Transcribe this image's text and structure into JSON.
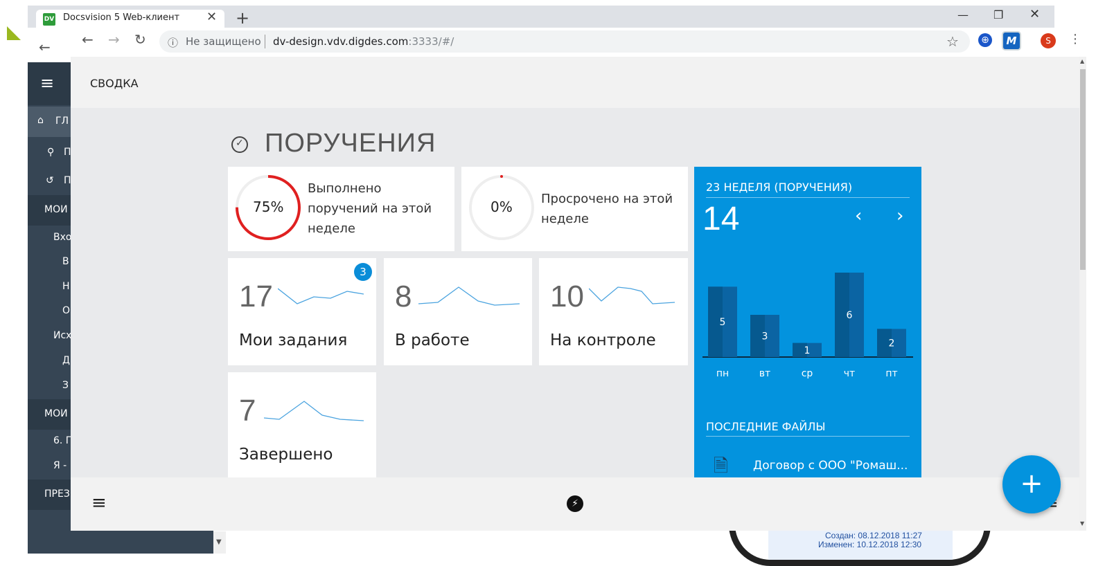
{
  "browser": {
    "tab_title": "Docsvision 5 Web-клиент",
    "tab_favicon": "DV",
    "omnibox_security": "Не защищено",
    "url_host": "dv-design.vdv.digdes.com",
    "url_rest": ":3333/#/",
    "profile_initial": "S",
    "ext_label": "M"
  },
  "background_sidebar": {
    "home": "ГЛ",
    "search": "П",
    "history": "П",
    "section1": "МОИ",
    "item1": "Вхо",
    "item2": "В",
    "item3": "Н",
    "item4": "О",
    "item5": "Исх",
    "item6": "Д",
    "item7": "З",
    "section2": "МОИ",
    "item8": "6. Г",
    "item9": "Я -",
    "section3": "ПРЕЗ"
  },
  "background_phone": {
    "created": "Создан: 08.12.2018 11:27",
    "modified": "Изменен: 10.12.2018 12:30"
  },
  "app": {
    "header_title": "СВОДКА",
    "section_title": "ПОРУЧЕНИЯ",
    "done_card": {
      "percent_label": "75%",
      "percent_value": 0.75,
      "description": "Выполнено поручений на этой неделе"
    },
    "overdue_card": {
      "percent_label": "0%",
      "percent_value": 0.0,
      "description": "Просрочено на этой неделе"
    },
    "stats": [
      {
        "value": "17",
        "label": "Мои задания",
        "badge": "3"
      },
      {
        "value": "8",
        "label": "В работе"
      },
      {
        "value": "10",
        "label": "На контроле"
      },
      {
        "value": "7",
        "label": "Завершено"
      }
    ],
    "week_panel": {
      "title": "23 НЕДЕЛЯ (ПОРУЧЕНИЯ)",
      "count": "14",
      "prev": "‹",
      "next": "›",
      "files_title": "ПОСЛЕДНИЕ ФАЙЛЫ",
      "file_name": "Договор с ООО \"Ромаш..."
    },
    "fab_label": "+"
  },
  "chart_data": {
    "type": "bar",
    "categories": [
      "пн",
      "вт",
      "ср",
      "чт",
      "пт"
    ],
    "values": [
      5,
      3,
      1,
      6,
      2
    ],
    "title": "",
    "xlabel": "",
    "ylabel": "",
    "ylim": [
      0,
      6
    ]
  },
  "colors": {
    "accent_blue": "#0393de",
    "progress_red": "#e02020",
    "sidebar_dark": "#364554"
  }
}
